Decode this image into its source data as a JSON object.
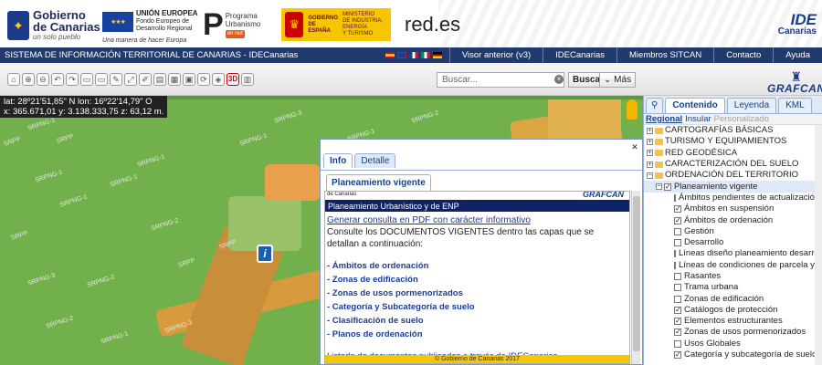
{
  "header": {
    "gobierno_title": "Gobierno\nde Canarias",
    "gobierno_slogan": "un solo pueblo",
    "eu_title": "UNIÓN EUROPEA",
    "eu_fund": "Fondo Europeo de\nDesarrollo Regional",
    "eu_slogan": "Una manera de hacer Europa",
    "programa_text": "Programa\nUrbanismo",
    "programa_badge": "en red",
    "gob_es_text": "GOBIERNO\nDE ESPAÑA",
    "ministerio_text": "MINISTERIO\nDE INDUSTRIA, ENERGÍA\nY TURISMO",
    "redes_logo": "red.es",
    "ide_logo": "IDE",
    "ide_sub": "Canarias"
  },
  "navbar": {
    "title": "SISTEMA DE INFORMACIÓN TERRITORIAL DE CANARIAS - IDECanarias",
    "links": [
      "Visor anterior (v3)",
      "IDECanarias",
      "Miembros SITCAN",
      "Contacto",
      "Ayuda"
    ],
    "flag_colors": [
      "#c60b1e",
      "#1f3e8a",
      "#cf142b",
      "#dddddd",
      "#ffce00"
    ]
  },
  "toolbar": {
    "tools": [
      "⌂",
      "⊕",
      "⊖",
      "↶",
      "↷",
      "▭",
      "▭",
      "✎",
      "⤢",
      "✐",
      "▤",
      "▦",
      "▣",
      "⟳",
      "◈",
      "3D",
      "▥"
    ],
    "search_placeholder": "Buscar...",
    "search_button": "Buscar",
    "mas_button": "Más",
    "grafcan_logo": "GRAFCAN"
  },
  "coords": {
    "line1": "lat: 28º21'51,85\" N  lon: 16º22'14,79\" O",
    "line2": "x: 365.671,01  y: 3.138.333,75  z: 63,12 m."
  },
  "map": {
    "labels": [
      "SRPP",
      "SRPNG-1",
      "SRPP",
      "SRPNG-1",
      "SRPNG-1",
      "SRPNG-1",
      "SRPP",
      "SRPNG-3",
      "SRPNG-2",
      "SRPNG-2",
      "SRPNG-1",
      "SRPNG-2",
      "SRPP",
      "SRPNG-3",
      "SRPNG-1",
      "SRPNG-1",
      "SRPP",
      "SRPNG-3",
      "SRPNG-2",
      "SRPNG-1"
    ]
  },
  "info_window": {
    "tabs": [
      "Info",
      "Detalle"
    ],
    "subtab": "Planeamiento vigente",
    "header_small": "de Canarias",
    "header_logo": "GRAFCAN",
    "header_bar": "Planeamiento Urbanístico y de ENP",
    "pdf_link": "Generar consulta en PDF con carácter informativo",
    "intro_text": "Consulte los DOCUMENTOS VIGENTES dentro las capas que se detallan a continuación:",
    "links": [
      "- Ámbitos de ordenación",
      "- Zonas de edificación",
      "- Zonas de usos pormenorizados",
      "- Categoría y Subcategoría de suelo",
      "- Clasificación de suelo",
      "- Planos de ordenación"
    ],
    "footer_link": "Listado de documentos publicados a través de IDECanarias",
    "copyright": "© Gobierno de Canarias 2017"
  },
  "side_panel": {
    "tabs": [
      "Contenido",
      "Leyenda",
      "KML"
    ],
    "subtabs": [
      "Regional",
      "Insular",
      "Personalizado"
    ],
    "tree": [
      {
        "label": "CARTOGRAFÍAS BÁSICAS",
        "type": "folder"
      },
      {
        "label": "TURISMO Y EQUIPAMIENTOS",
        "type": "folder"
      },
      {
        "label": "RED GEODÉSICA",
        "type": "folder"
      },
      {
        "label": "CARACTERIZACIÓN DEL SUELO",
        "type": "folder"
      },
      {
        "label": "ORDENACIÓN DEL TERRITORIO",
        "type": "folder"
      },
      {
        "label": "Planeamiento vigente",
        "type": "group",
        "checked": true
      },
      {
        "label": "Ámbitos pendientes de actualización en",
        "type": "layer",
        "checked": false
      },
      {
        "label": "Ámbitos en suspensión",
        "type": "layer",
        "checked": true
      },
      {
        "label": "Ámbitos de ordenación",
        "type": "layer",
        "checked": true
      },
      {
        "label": "Gestión",
        "type": "layer",
        "checked": false
      },
      {
        "label": "Desarrollo",
        "type": "layer",
        "checked": false
      },
      {
        "label": "Líneas diseño planeamiento desarrollo",
        "type": "layer",
        "checked": false
      },
      {
        "label": "Líneas de condiciones de parcela y disp",
        "type": "layer",
        "checked": false
      },
      {
        "label": "Rasantes",
        "type": "layer",
        "checked": false
      },
      {
        "label": "Trama urbana",
        "type": "layer",
        "checked": false
      },
      {
        "label": "Zonas de edificación",
        "type": "layer",
        "checked": false
      },
      {
        "label": "Catálogos de protección",
        "type": "layer",
        "checked": true
      },
      {
        "label": "Elementos estructurantes",
        "type": "layer",
        "checked": true
      },
      {
        "label": "Zonas de usos pormenorizados",
        "type": "layer",
        "checked": true
      },
      {
        "label": "Usos Globales",
        "type": "layer",
        "checked": false
      },
      {
        "label": "Categoría y subcategoría de suelo",
        "type": "layer",
        "checked": true
      }
    ]
  }
}
